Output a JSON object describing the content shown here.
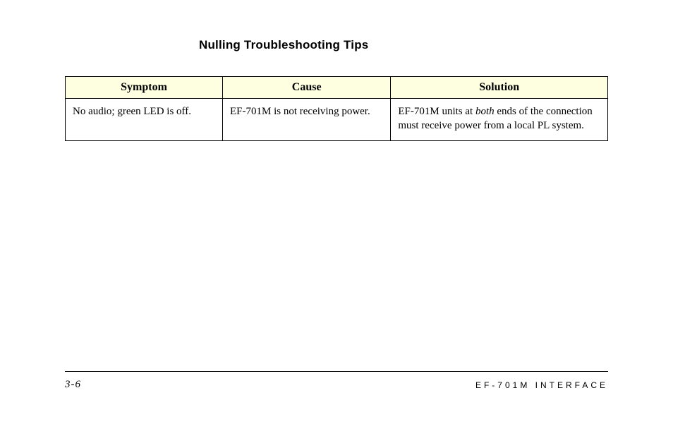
{
  "heading": "Nulling Troubleshooting Tips",
  "table": {
    "headers": {
      "symptom": "Symptom",
      "cause": "Cause",
      "solution": "Solution"
    },
    "rows": [
      {
        "symptom": "No audio; green LED is off.",
        "cause": "EF-701M is not receiving power.",
        "solution_pre": "EF-701M units at ",
        "solution_em": "both",
        "solution_post": " ends of the connection must receive power from a local PL system."
      }
    ]
  },
  "footer": {
    "page": "3-6",
    "doc": "EF-701M INTERFACE"
  }
}
